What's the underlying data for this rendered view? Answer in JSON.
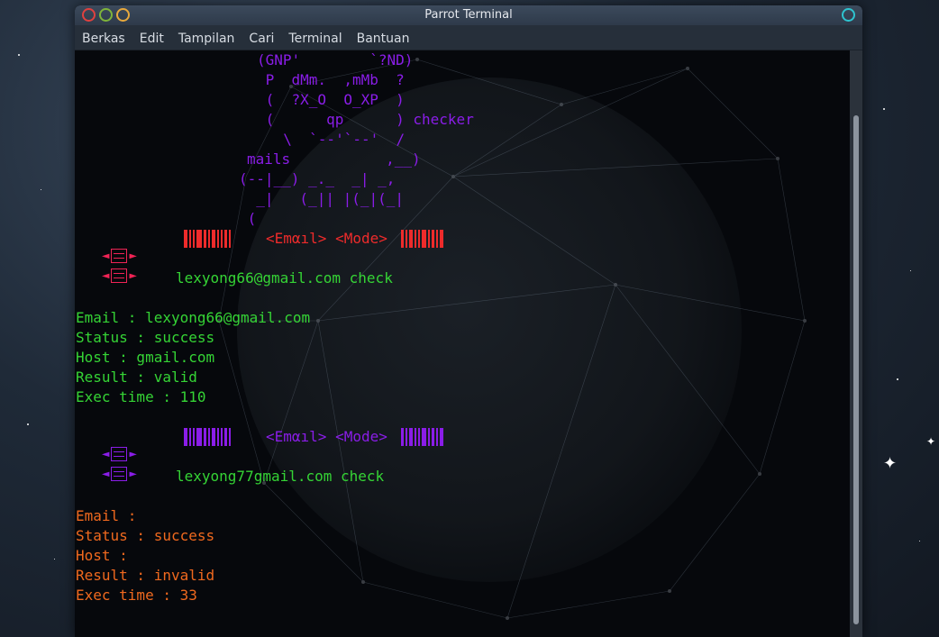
{
  "window": {
    "title": "Parrot Terminal"
  },
  "menu": [
    "Berkas",
    "Edit",
    "Tampilan",
    "Cari",
    "Terminal",
    "Bantuan"
  ],
  "banner": [
    "(GNP'        `?ND)",
    " P  dMm.  ,mMb  ?",
    " (  ?X_O  O_XP  )",
    " (      qp      ) checker",
    "  \\  `--'`--'  /",
    "mails           ,__)",
    "(--|__) _._  _| _,",
    "  _|   (_|| |(_|(_|",
    " ("
  ],
  "mode_label": "<Emαıl> <Mode>",
  "entries": [
    {
      "command": "lexyong66@gmail.com check",
      "email_line": "Email : lexyong66@gmail.com",
      "status_line": "Status : success",
      "host_line": "Host : gmail.com",
      "result_line": "Result : valid",
      "exec_line": "Exec time : 110"
    },
    {
      "command": "lexyong77gmail.com check",
      "email_line": "Email :",
      "status_line": "Status : success",
      "host_line": "Host :",
      "result_line": "Result : invalid",
      "exec_line": "Exec time : 33"
    }
  ],
  "colors": {
    "banner": "#8a1de8",
    "valid": "#35d435",
    "invalid": "#f0691e",
    "mode_red": "#ee2b2b",
    "mode_purple": "#8a1de8"
  }
}
